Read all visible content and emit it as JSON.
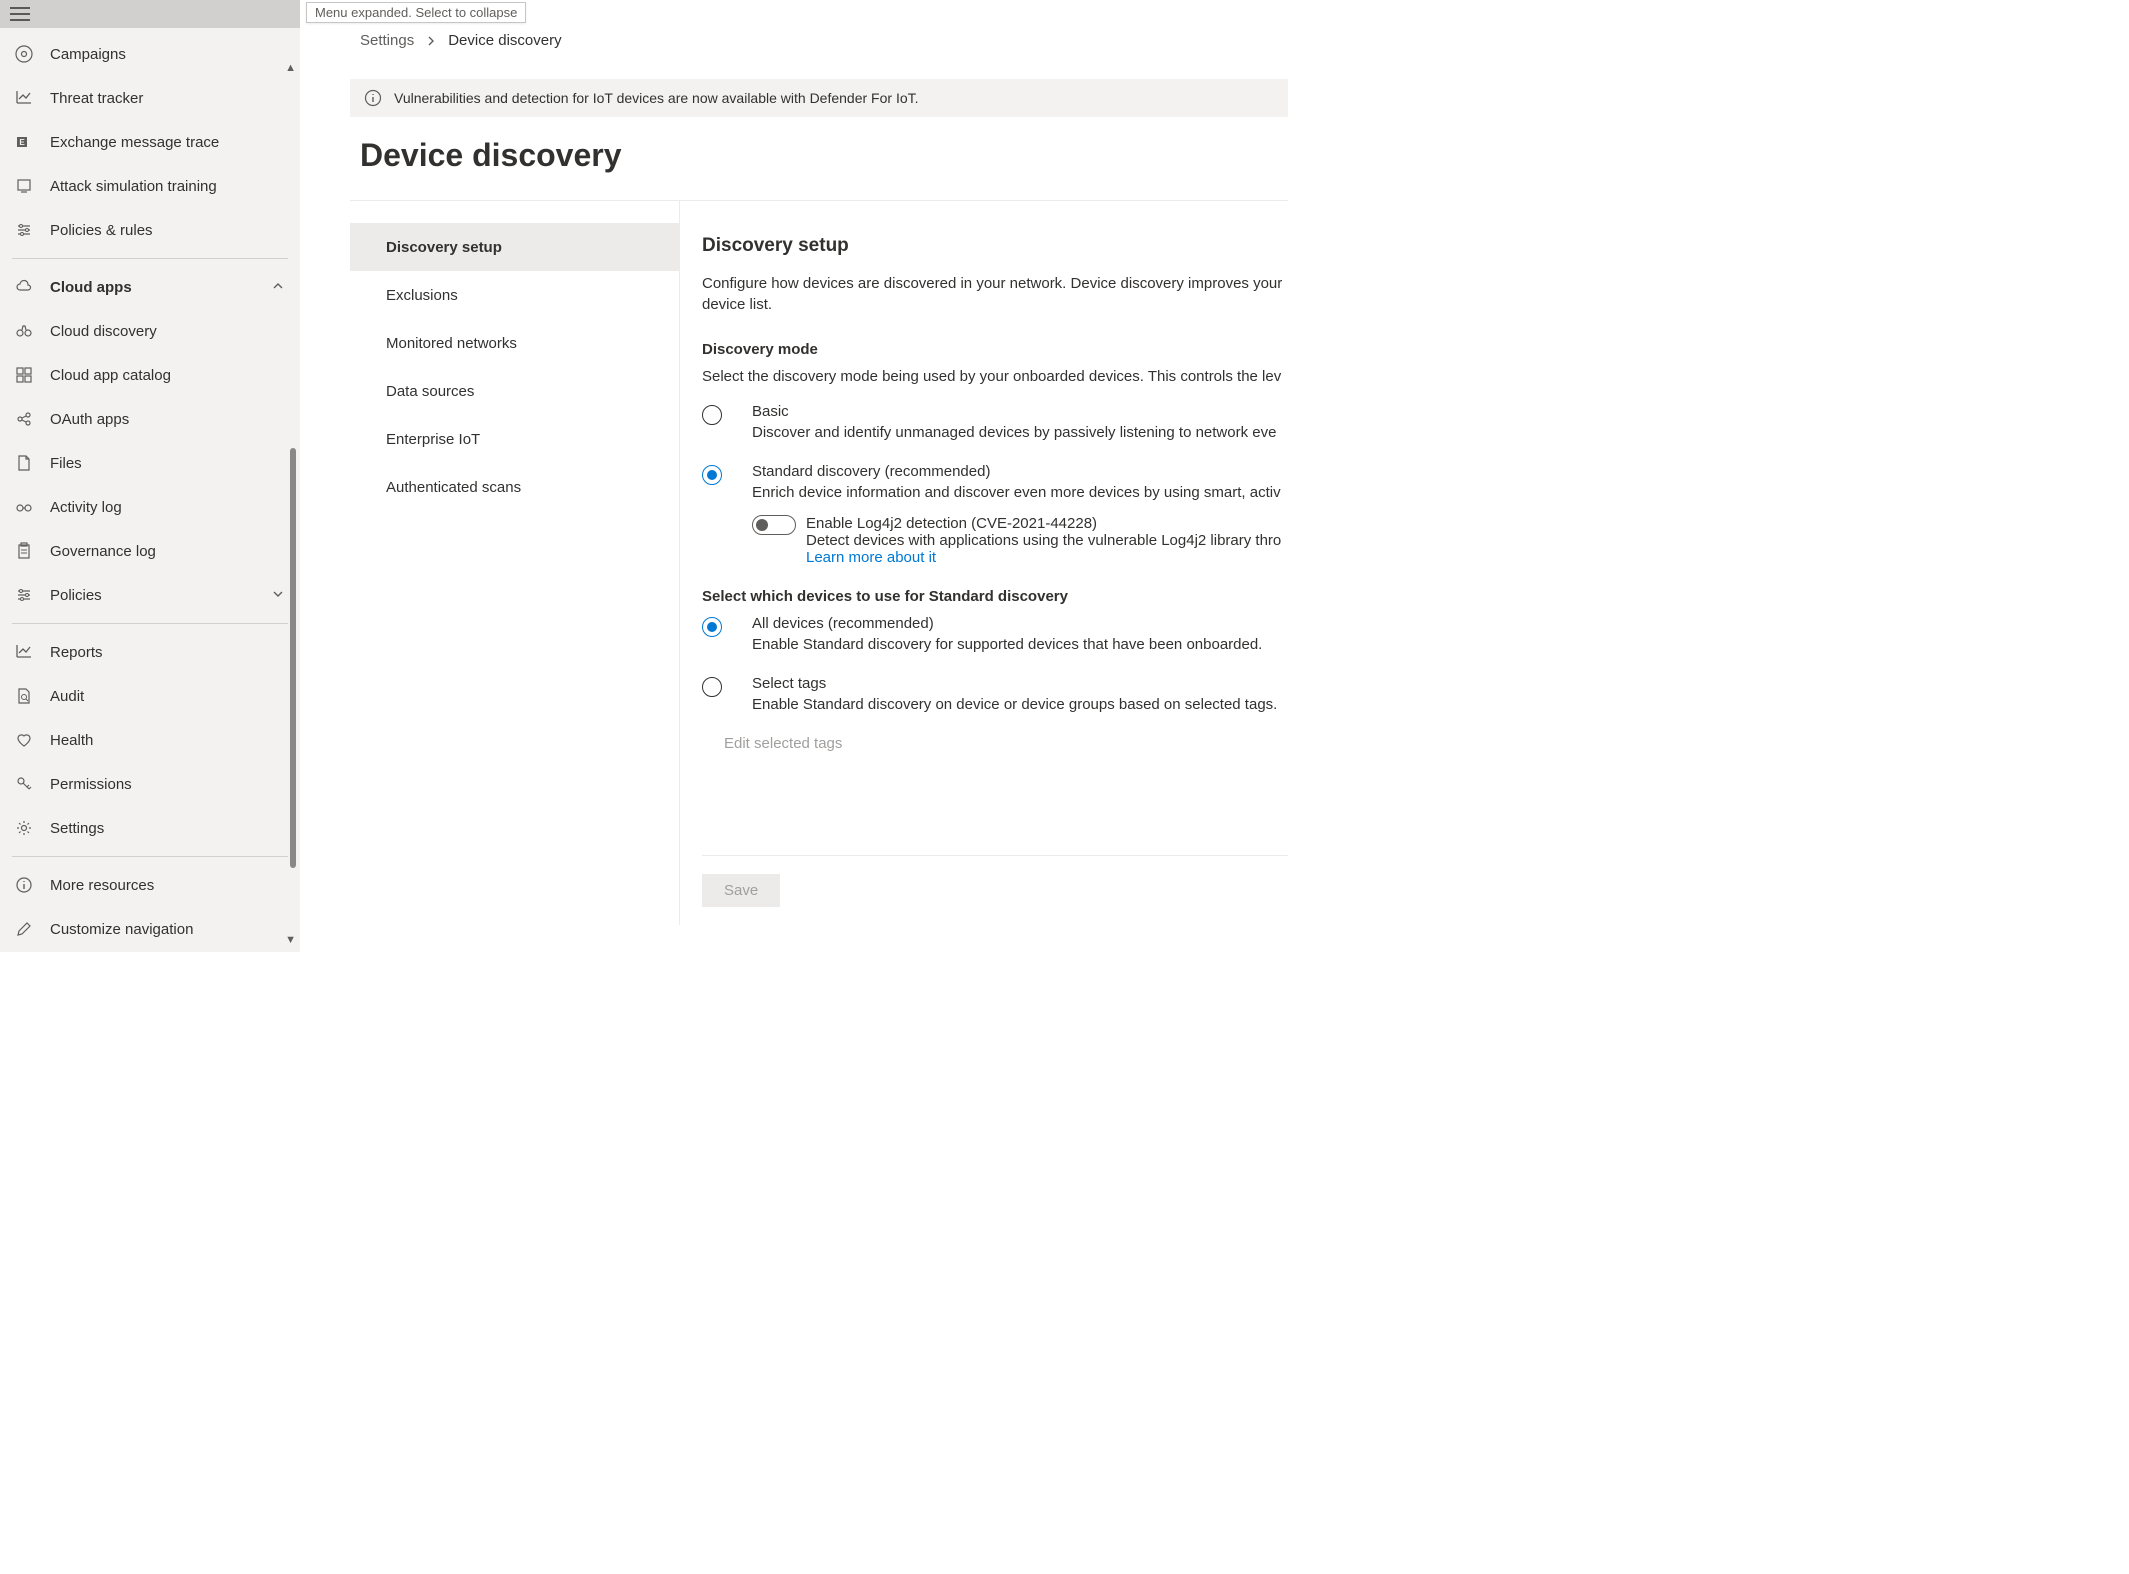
{
  "tooltip": "Menu expanded. Select to collapse",
  "sidebar": {
    "items": [
      {
        "icon": "target",
        "label": "Campaigns"
      },
      {
        "icon": "trend",
        "label": "Threat tracker"
      },
      {
        "icon": "exchange",
        "label": "Exchange message trace"
      },
      {
        "icon": "training",
        "label": "Attack simulation training"
      },
      {
        "icon": "sliders",
        "label": "Policies & rules"
      }
    ],
    "cloudApps": {
      "label": "Cloud apps",
      "items": [
        {
          "icon": "binoculars",
          "label": "Cloud discovery"
        },
        {
          "icon": "grid",
          "label": "Cloud app catalog"
        },
        {
          "icon": "oauth",
          "label": "OAuth apps"
        },
        {
          "icon": "file",
          "label": "Files"
        },
        {
          "icon": "spectacles",
          "label": "Activity log"
        },
        {
          "icon": "clipboard",
          "label": "Governance log"
        },
        {
          "icon": "sliders",
          "label": "Policies",
          "expandable": true
        }
      ]
    },
    "bottom": [
      {
        "icon": "chart",
        "label": "Reports"
      },
      {
        "icon": "audit",
        "label": "Audit"
      },
      {
        "icon": "heart",
        "label": "Health"
      },
      {
        "icon": "key",
        "label": "Permissions"
      },
      {
        "icon": "gear",
        "label": "Settings"
      }
    ],
    "footer": [
      {
        "icon": "info",
        "label": "More resources"
      },
      {
        "icon": "pencil",
        "label": "Customize navigation"
      }
    ]
  },
  "breadcrumb": {
    "root": "Settings",
    "current": "Device discovery"
  },
  "banner": "Vulnerabilities and detection for IoT devices are now available with Defender For IoT.",
  "pageTitle": "Device discovery",
  "subnav": [
    "Discovery setup",
    "Exclusions",
    "Monitored networks",
    "Data sources",
    "Enterprise IoT",
    "Authenticated scans"
  ],
  "detail": {
    "heading": "Discovery setup",
    "description": "Configure how devices are discovered in your network. Device discovery improves your device list.",
    "modeLabel": "Discovery mode",
    "modeDesc": "Select the discovery mode being used by your onboarded devices. This controls the lev",
    "basic": {
      "title": "Basic",
      "desc": "Discover and identify unmanaged devices by passively listening to network eve"
    },
    "standard": {
      "title": "Standard discovery (recommended)",
      "desc": "Enrich device information and discover even more devices by using smart, activ"
    },
    "log4j": {
      "title": "Enable Log4j2 detection (CVE-2021-44228)",
      "desc": "Detect devices with applications using the vulnerable Log4j2 library thro",
      "link": "Learn more about it"
    },
    "selectDevicesLabel": "Select which devices to use for Standard discovery",
    "allDevices": {
      "title": "All devices (recommended)",
      "desc": "Enable Standard discovery for supported devices that have been onboarded."
    },
    "selectTags": {
      "title": "Select tags",
      "desc": "Enable Standard discovery on device or device groups based on selected tags."
    },
    "editTags": "Edit selected tags",
    "save": "Save"
  }
}
